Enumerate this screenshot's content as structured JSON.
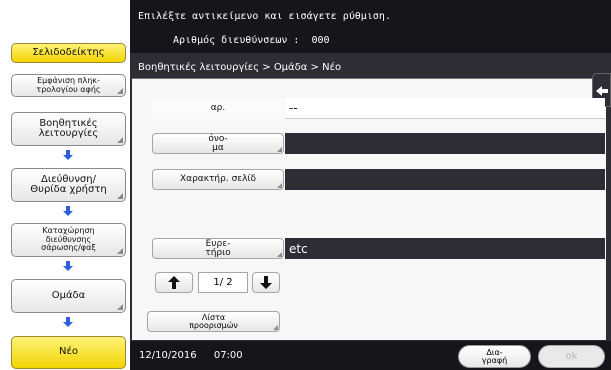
{
  "header": {
    "instruction": "Επιλέξτε αντικείμενο και εισάγετε ρύθμιση.",
    "address_number_label": "Αριθμός διευθύνσεων :",
    "address_number_value": "000"
  },
  "left_nav": {
    "bookmark": "Σελιδοδείκτης",
    "keypad_display": "Εμφάνιση πληκ-\nτρολογίου αφής",
    "utility": "Βοηθητικές\nλειτουργίες",
    "address_user_box": "Διεύθυνση/\nΘυρίδα χρήστη",
    "dest_registration": "Καταχώρηση\nδιεύθυνσης\nσάρωσης/φαξ",
    "group": "Ομάδα",
    "new": "Νέο"
  },
  "breadcrumb": "Βοηθητικές λειτουργίες > Ομάδα > Νέο",
  "fields": {
    "number_label": "αρ.",
    "number_value": "--",
    "name_label": "όνο-\nμα",
    "name_value": "",
    "char_label": "Χαρακτήρ. σελίδ",
    "char_value": "",
    "index_label": "Ευρε-\nτήριο",
    "index_value": "etc"
  },
  "paging": {
    "indicator": "1/ 2"
  },
  "dest_list_button": "Λίστα\nπροορισμών",
  "footer": {
    "date": "12/10/2016",
    "time": "07:00",
    "delete": "Δια-\nγραφή",
    "ok": "ok"
  },
  "colors": {
    "accent_yellow": "#f3d400",
    "nav_arrow_blue": "#2e5fd6",
    "dark_panel": "#2d2d36",
    "top_bar": "#15151b"
  },
  "icons": {
    "nav_arrow": "arrow-down-icon",
    "page_up": "arrow-up-icon",
    "page_down": "arrow-down-icon",
    "side_tab": "arrow-left-icon"
  }
}
